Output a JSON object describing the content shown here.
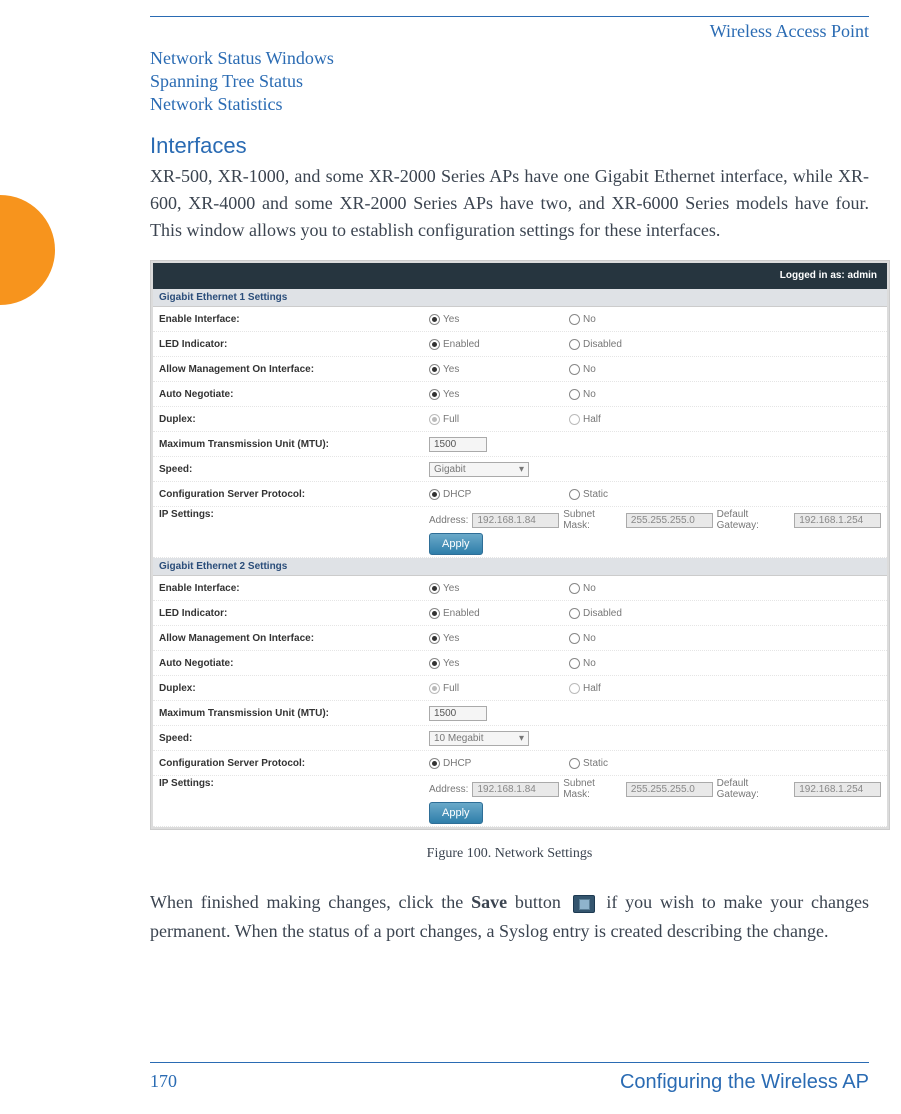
{
  "header": {
    "running_title": "Wireless Access Point"
  },
  "nav_links": [
    "Network Status Windows",
    "Spanning Tree Status",
    "Network Statistics"
  ],
  "section": {
    "heading": "Interfaces",
    "paragraph": "XR-500, XR-1000, and some XR-2000 Series APs have one Gigabit Ethernet interface, while XR- 600, XR-4000 and some XR-2000 Series APs have two, and XR-6000 Series models have four. This window allows you to establish configuration settings for these interfaces."
  },
  "figure": {
    "login_label": "Logged in as: admin",
    "sections": [
      {
        "title": "Gigabit Ethernet 1 Settings",
        "rows": {
          "enable": {
            "label": "Enable Interface:",
            "opt_a": "Yes",
            "opt_b": "No",
            "sel": "a"
          },
          "led": {
            "label": "LED Indicator:",
            "opt_a": "Enabled",
            "opt_b": "Disabled",
            "sel": "a"
          },
          "mgmt": {
            "label": "Allow Management On Interface:",
            "opt_a": "Yes",
            "opt_b": "No",
            "sel": "a"
          },
          "autoneg": {
            "label": "Auto Negotiate:",
            "opt_a": "Yes",
            "opt_b": "No",
            "sel": "a"
          },
          "duplex": {
            "label": "Duplex:",
            "opt_a": "Full",
            "opt_b": "Half",
            "sel": "a",
            "disabled": true
          },
          "mtu": {
            "label": "Maximum Transmission Unit (MTU):",
            "value": "1500"
          },
          "speed": {
            "label": "Speed:",
            "value": "Gigabit"
          },
          "cfgproto": {
            "label": "Configuration Server Protocol:",
            "opt_a": "DHCP",
            "opt_b": "Static",
            "sel": "a"
          },
          "ip": {
            "label": "IP Settings:",
            "addr_label": "Address:",
            "addr": "192.168.1.84",
            "mask_label": "Subnet Mask:",
            "mask": "255.255.255.0",
            "gw_label": "Default Gateway:",
            "gw": "192.168.1.254",
            "apply": "Apply"
          }
        }
      },
      {
        "title": "Gigabit Ethernet 2 Settings",
        "rows": {
          "enable": {
            "label": "Enable Interface:",
            "opt_a": "Yes",
            "opt_b": "No",
            "sel": "a"
          },
          "led": {
            "label": "LED Indicator:",
            "opt_a": "Enabled",
            "opt_b": "Disabled",
            "sel": "a"
          },
          "mgmt": {
            "label": "Allow Management On Interface:",
            "opt_a": "Yes",
            "opt_b": "No",
            "sel": "a"
          },
          "autoneg": {
            "label": "Auto Negotiate:",
            "opt_a": "Yes",
            "opt_b": "No",
            "sel": "a"
          },
          "duplex": {
            "label": "Duplex:",
            "opt_a": "Full",
            "opt_b": "Half",
            "sel": "a",
            "disabled": true
          },
          "mtu": {
            "label": "Maximum Transmission Unit (MTU):",
            "value": "1500"
          },
          "speed": {
            "label": "Speed:",
            "value": "10 Megabit"
          },
          "cfgproto": {
            "label": "Configuration Server Protocol:",
            "opt_a": "DHCP",
            "opt_b": "Static",
            "sel": "a"
          },
          "ip": {
            "label": "IP Settings:",
            "addr_label": "Address:",
            "addr": "192.168.1.84",
            "mask_label": "Subnet Mask:",
            "mask": "255.255.255.0",
            "gw_label": "Default Gateway:",
            "gw": "192.168.1.254",
            "apply": "Apply"
          }
        }
      }
    ],
    "caption": "Figure 100. Network Settings"
  },
  "after": {
    "pre": "When finished making changes, click the ",
    "save_word": "Save",
    "mid": " button ",
    "post": " if you wish to make your changes permanent. When the status of a port changes, a Syslog entry is created describing the change."
  },
  "footer": {
    "page": "170",
    "title": "Configuring the Wireless AP"
  }
}
